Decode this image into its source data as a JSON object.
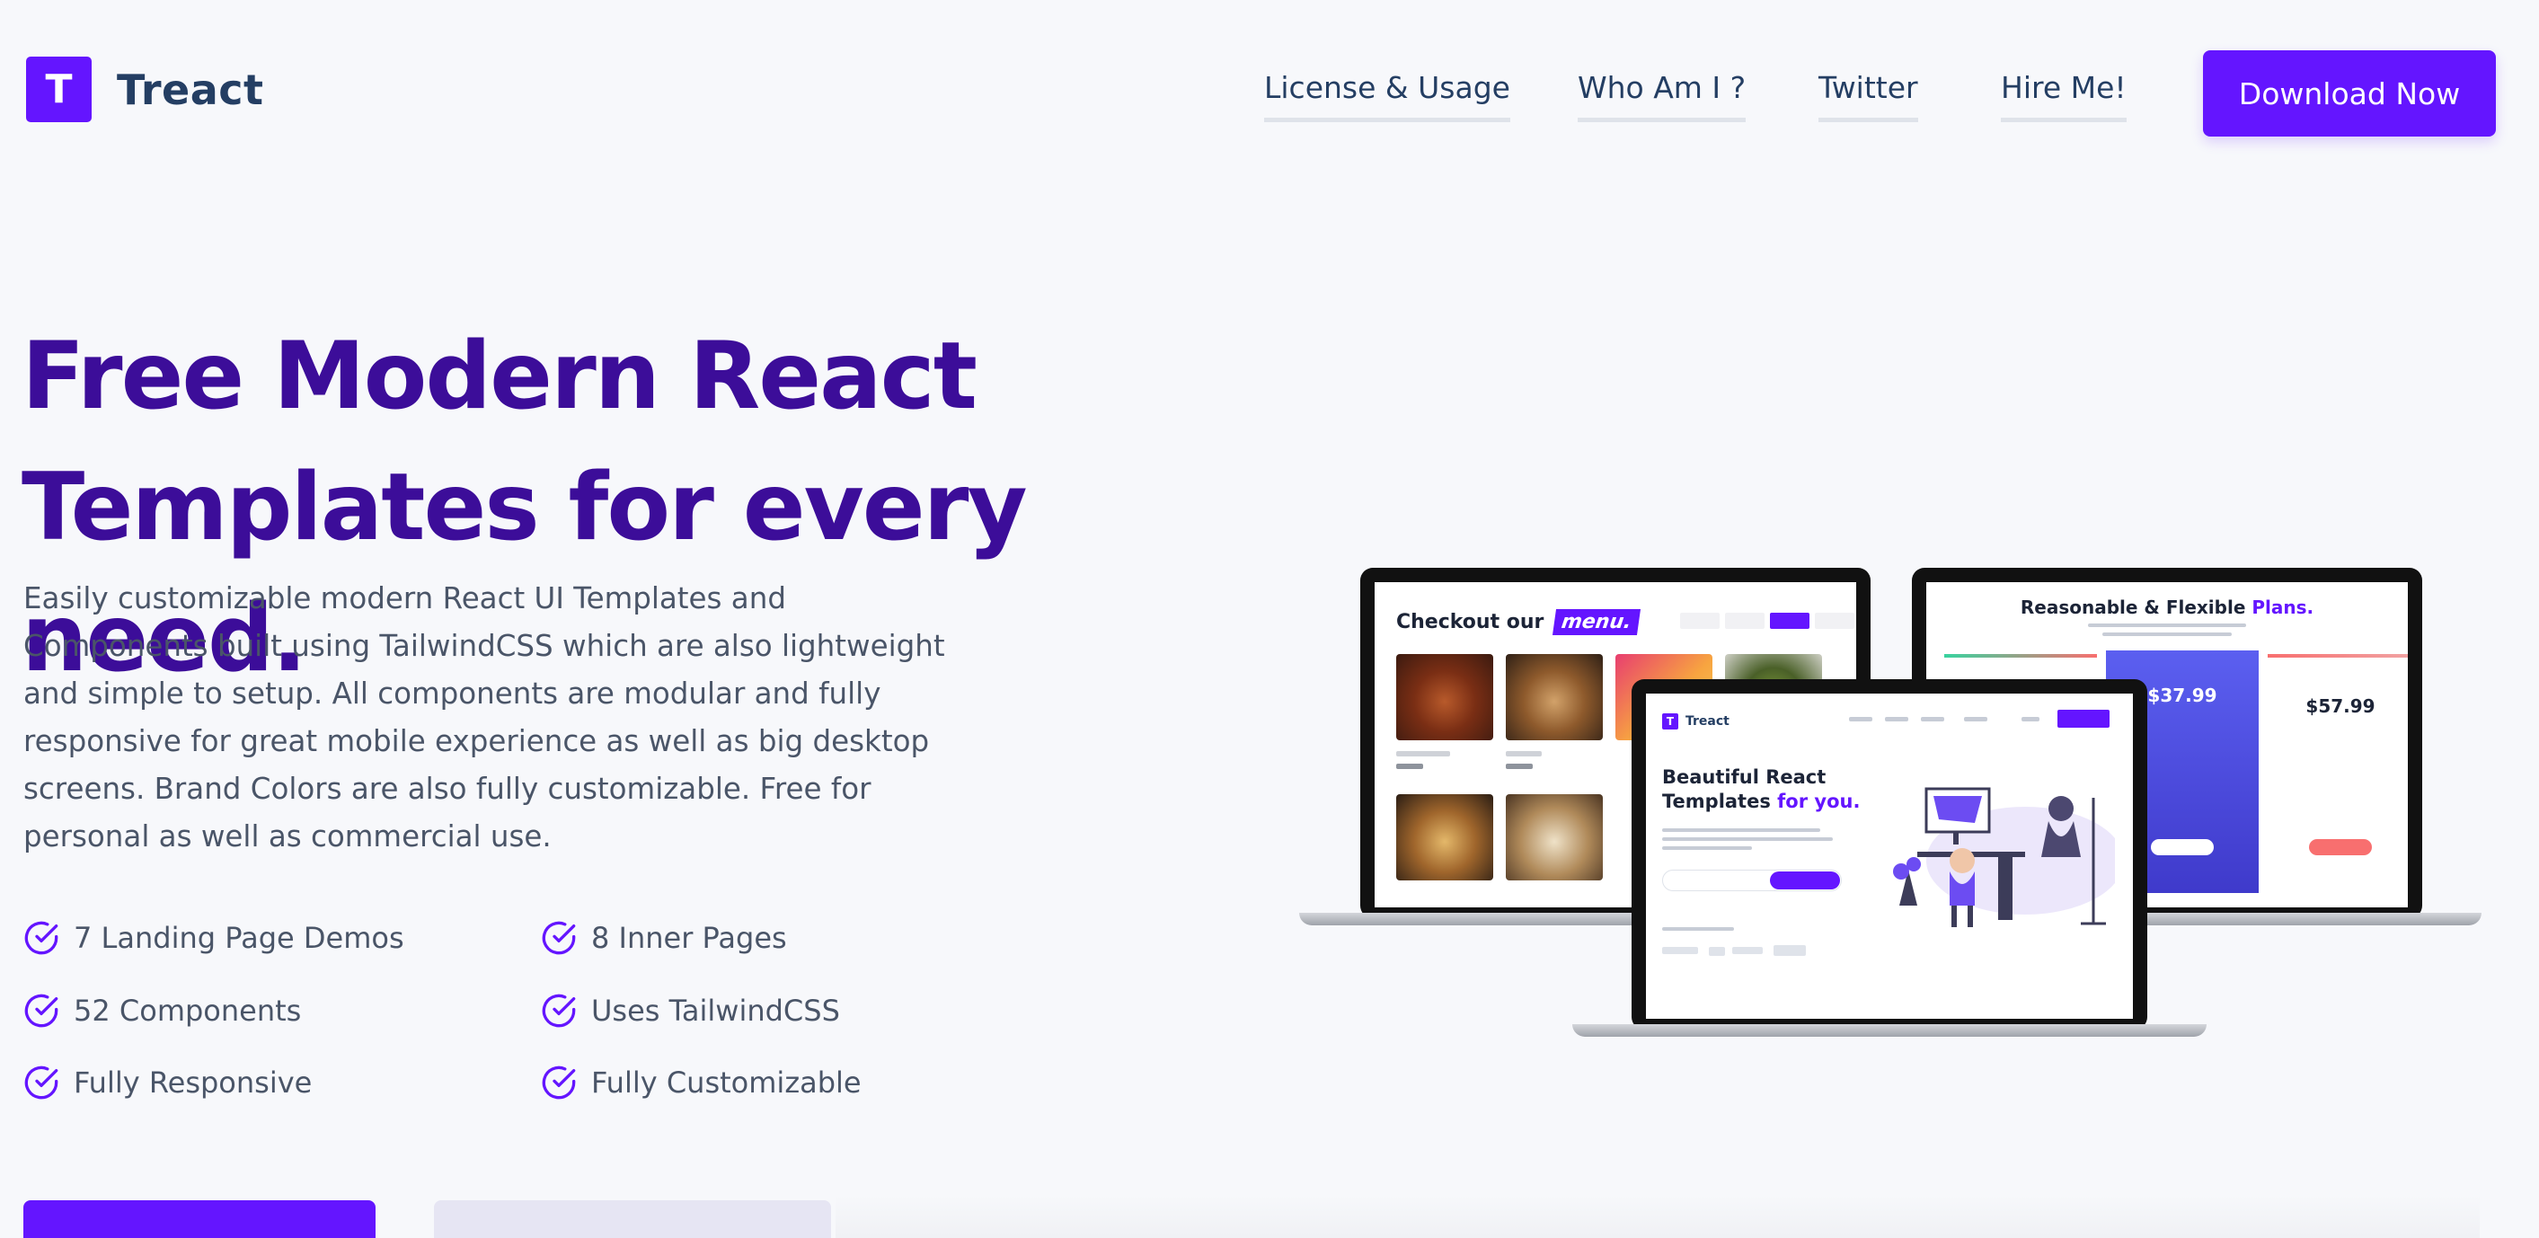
{
  "header": {
    "logo_letter": "T",
    "brand": "Treact",
    "nav": [
      "License & Usage",
      "Who Am I ?",
      "Twitter",
      "Hire Me!"
    ],
    "cta": "Download Now"
  },
  "hero": {
    "title_line1": "Free Modern React",
    "title_line2": "Templates for every need.",
    "description": "Easily customizable modern React UI Templates and Components built using TailwindCSS which are also lightweight and simple to setup. All components are modular and fully responsive for great mobile experience as well as big desktop screens. Brand Colors are also fully customizable. Free for personal as well as commercial use.",
    "features": [
      "7 Landing Page Demos",
      "8 Inner Pages",
      "52 Components",
      "Uses TailwindCSS",
      "Fully Responsive",
      "Fully Customizable"
    ]
  },
  "mockups": {
    "menu": {
      "heading": "Checkout our",
      "highlight": "menu."
    },
    "pricing": {
      "heading": "Reasonable & Flexible",
      "highlight": "Plans.",
      "price_a": "$37.99",
      "price_b": "$57.99"
    },
    "landing": {
      "brand": "Treact",
      "title_line1": "Beautiful React",
      "title_line2": "Templates",
      "highlight": "for you."
    }
  },
  "colors": {
    "primary": "#6415ff",
    "heading": "#3c0d99",
    "text": "#4a5568",
    "nav_text": "#243e63",
    "background": "#f7f8fb"
  }
}
